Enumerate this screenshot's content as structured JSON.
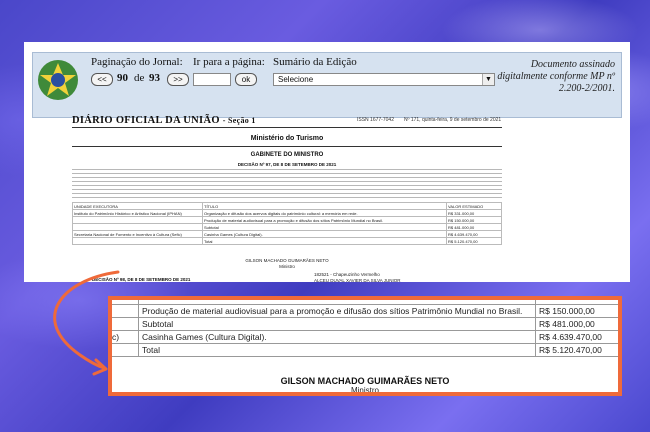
{
  "navbar": {
    "pagination_label": "Paginação do Jornal:",
    "prev_button": "<<",
    "next_button": ">>",
    "current_page": "90",
    "of_word": "de",
    "total_pages": "93",
    "goto_label": "Ir para a página:",
    "ok_button": "ok",
    "summary_label": "Sumário da Edição",
    "summary_select": "Selecione",
    "signed_note": "Documento assinado digitalmente conforme MP nº 2.200-2/2001."
  },
  "document": {
    "title": "DIÁRIO OFICIAL DA UNIÃO",
    "section": "- Seção 1",
    "issn": "ISSN 1677-7042",
    "issue": "Nº 171, quinta-feira, 9 de setembro de 2021",
    "ministry": "Ministério do Turismo",
    "cabinet": "GABINETE DO MINISTRO",
    "decree": "DECISÃO Nº 97, DE 8 DE SETEMBRO DE 2021",
    "table": {
      "headers": [
        "UNIDADE EXECUTORA",
        "TÍTULO",
        "VALOR ESTIMADO"
      ],
      "rows": [
        [
          "Instituto do Patrimônio Histórico e Artístico Nacional (IPHAN)",
          "Organização e difusão dos acervos digitais do patrimônio cultural: a memória em rede.",
          "R$ 331.000,00"
        ],
        [
          "",
          "Produção de material audiovisual para a promoção e difusão dos sítios Patrimônio Mundial no Brasil.",
          "R$ 150.000,00"
        ],
        [
          "",
          "Subtotal",
          "R$ 481.000,00"
        ],
        [
          "Secretaria Nacional de Fomento e Incentivo à Cultura (Sefic)",
          "Casinha Games (Cultura Digital).",
          "R$ 4.639.470,00"
        ],
        [
          "",
          "Total",
          "R$ 5.120.470,00"
        ]
      ]
    },
    "signer": "GILSON MACHADO GUIMARÃES NETO",
    "signer_role": "Ministro",
    "decree2": "DECISÃO Nº 98, DE 8 DE SETEMBRO DE 2021",
    "sig2_line1": "182521 - Chapeuzinho Vermelho",
    "sig2_line2": "ALCEU DUVAL XAVIER DA SILVA JUNIOR"
  },
  "zoom": {
    "rows": [
      {
        "col0": "",
        "title": "Produção de material audiovisual para a promoção e difusão dos sítios Patrimônio Mundial no Brasil.",
        "value": "R$ 150.000,00"
      },
      {
        "col0": "",
        "title": "Subtotal",
        "value": "R$ 481.000,00"
      },
      {
        "col0": "c)",
        "title": "Casinha Games (Cultura Digital).",
        "value": "R$ 4.639.470,00"
      },
      {
        "col0": "",
        "title": "Total",
        "value": "R$ 5.120.470,00"
      }
    ],
    "signer": "GILSON MACHADO GUIMARÃES NETO",
    "signer_role": "Ministro"
  },
  "colors": {
    "highlight_border": "#ef6a3a",
    "background": "#4a47c9",
    "navbar": "#d6e2f0"
  }
}
